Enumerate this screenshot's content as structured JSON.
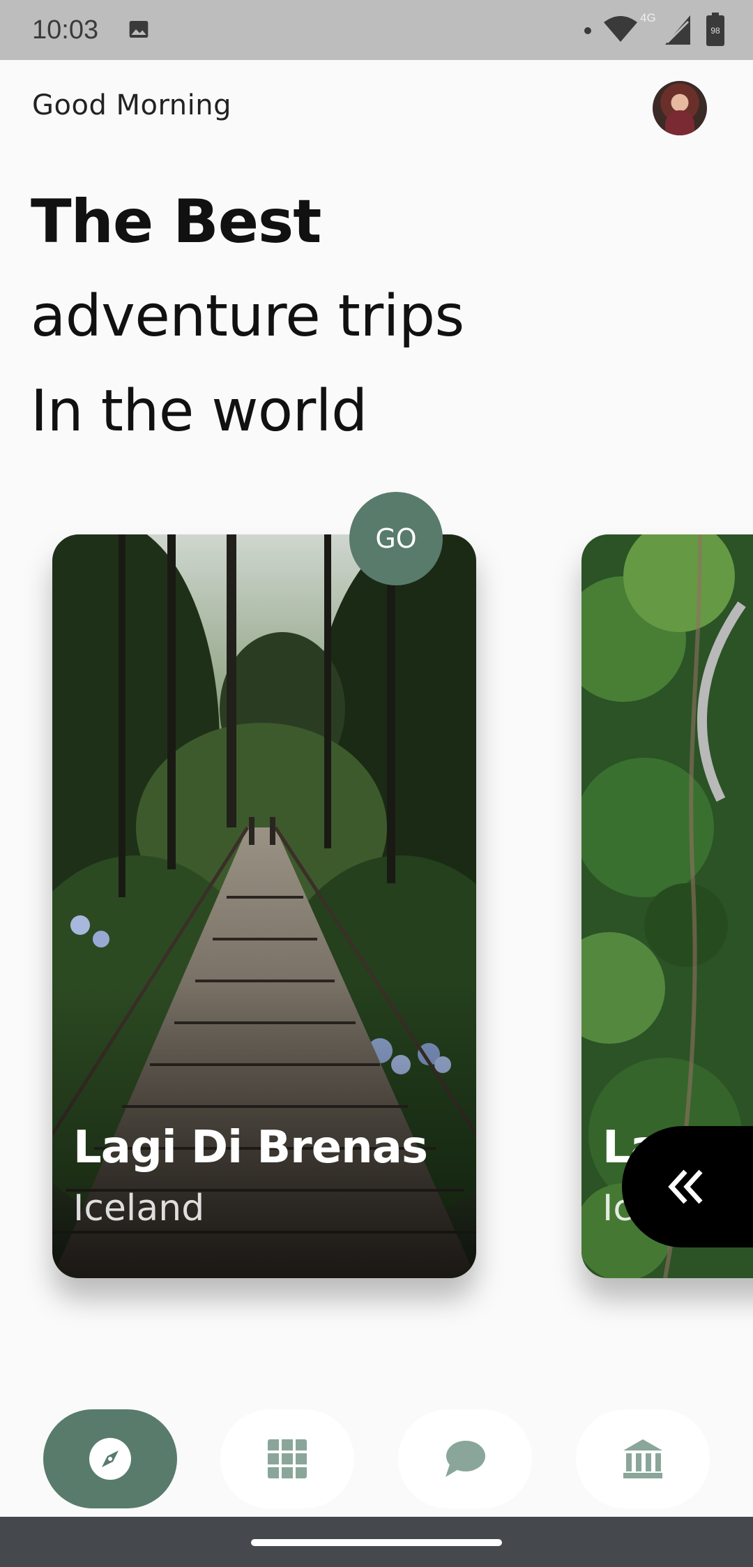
{
  "status_bar": {
    "time": "10:03",
    "network": "4G",
    "battery": "98",
    "icons": [
      "image-icon",
      "notification-dot-icon",
      "wifi-icon",
      "signal-icon",
      "battery-icon"
    ]
  },
  "header": {
    "greeting": "Good Morning",
    "avatar": "profile-avatar"
  },
  "headline": {
    "line1": "The Best",
    "line2": "adventure trips",
    "line3": "In the world"
  },
  "cards": [
    {
      "title": "Lagi Di Brenas",
      "subtitle": "Iceland"
    },
    {
      "title": "La",
      "subtitle": "Ic"
    }
  ],
  "go_button": {
    "label": "GO"
  },
  "bottom_nav": {
    "items": [
      {
        "icon": "compass-icon",
        "active": true
      },
      {
        "icon": "grid-icon",
        "active": false
      },
      {
        "icon": "chat-icon",
        "active": false
      },
      {
        "icon": "bank-icon",
        "active": false
      }
    ]
  },
  "colors": {
    "accent": "#587b6c",
    "nav_icon_inactive": "#8aa69a",
    "background": "#fafafa"
  }
}
